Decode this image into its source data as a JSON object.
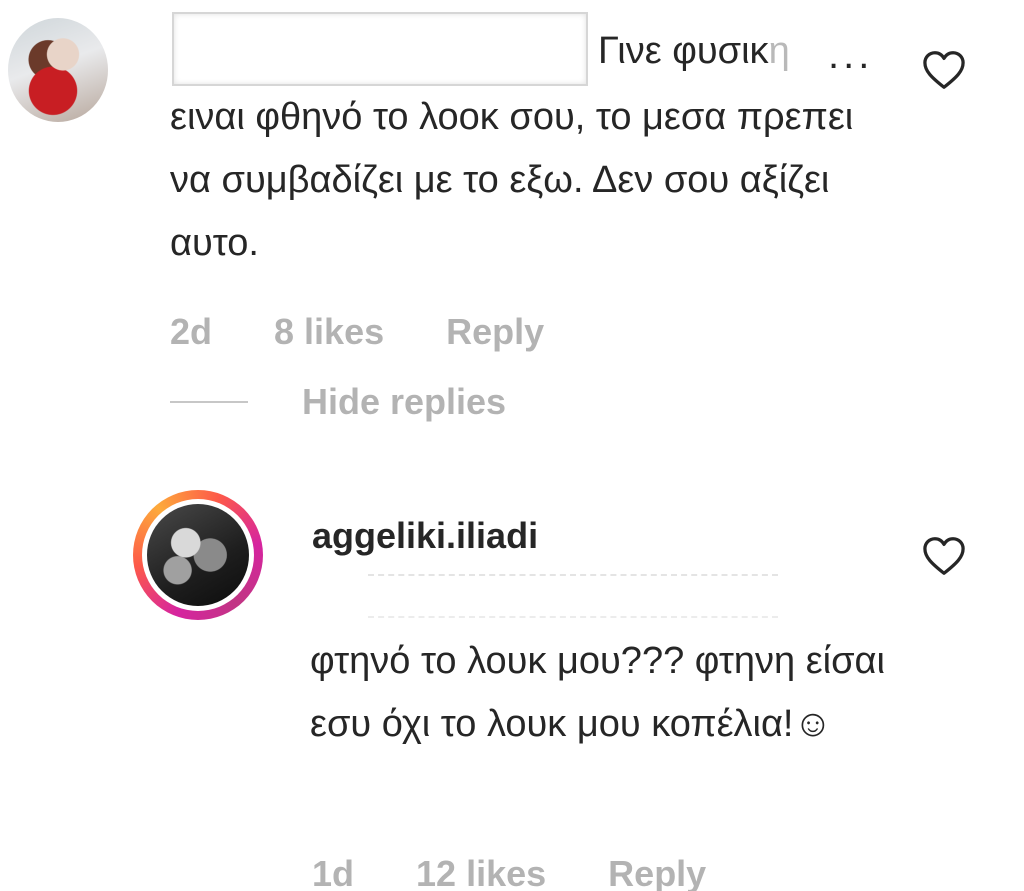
{
  "comment": {
    "first_line_text": "Γινε φυσικ",
    "first_line_fade": "η",
    "ellipsis": "...",
    "body": "ειναι φθηνό το λοοκ σου, το μεσα πρεπει να συμβαδίζει με το εξω. Δεν σου αξίζει αυτο.",
    "time": "2d",
    "likes": "8 likes",
    "reply_label": "Reply",
    "hide_replies_label": "Hide replies",
    "like_icon": "heart-outline-icon"
  },
  "reply": {
    "username": "aggeliki.iliadi",
    "body": "φτηνό το λουκ μου??? φτηνη είσαι εσυ όχι το λουκ μου κοπέλια!☺",
    "time": "1d",
    "likes": "12 likes",
    "reply_label": "Reply",
    "like_icon": "heart-outline-icon"
  }
}
